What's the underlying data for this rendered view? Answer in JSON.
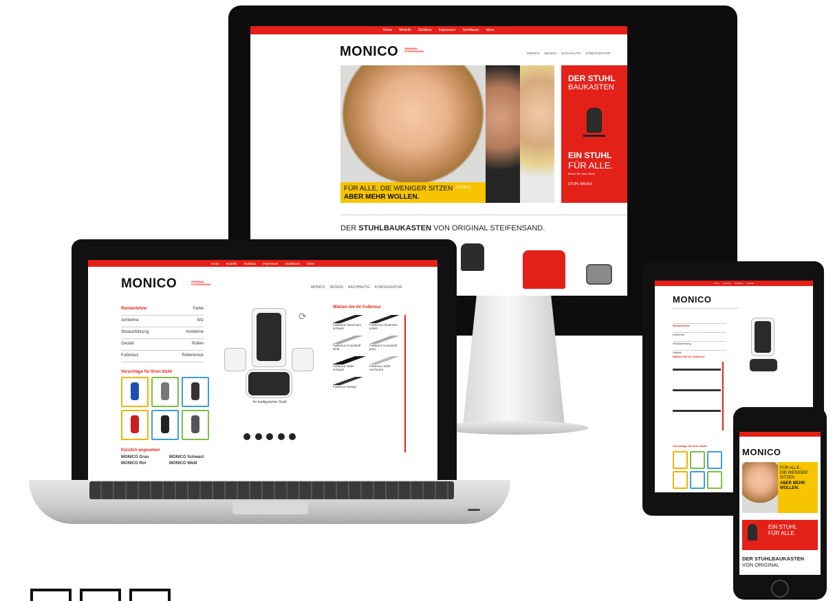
{
  "nav": {
    "items": [
      "Home",
      "Modelle",
      "Stuhlbau",
      "Impressum",
      "Stuhlbauer",
      "Ideen"
    ],
    "items_short": [
      "Home",
      "Modelle",
      "Stuhlbau",
      "Kontakt"
    ]
  },
  "header": {
    "logo": "MONICO",
    "logo_tagline_1": "ORIGINAL",
    "logo_tagline_2": "STEIFENSAND",
    "links": [
      "MONICO",
      "DESIGN",
      "NACHHALTIG",
      "KONFIGURATOR"
    ]
  },
  "desktop": {
    "hero_text_1": "FÜR ALLE, DIE WENIGER SITZEN",
    "hero_text_2": "ABER MEHR WOLLEN.",
    "hero_button": "DETAILS",
    "promo_title_1": "DER STUHL",
    "promo_title_2": "BAUKASTEN",
    "promo_slogan_1": "EIN STUHL",
    "promo_slogan_2": "FÜR ALLE.",
    "promo_small": "Bauen Sie Ihren Stuhl",
    "promo_button": "STUHL BAUEN",
    "section_prefix": "DER",
    "section_strong": "STUHLBAUKASTEN",
    "section_suffix": "VON ORIGINAL STEIFENSAND."
  },
  "configurator": {
    "filters": [
      {
        "label": "Rückenlehne",
        "value": "Farbe"
      },
      {
        "label": "Armlehne",
        "value": "Sitz"
      },
      {
        "label": "Sitzausführung",
        "value": "Armlehne"
      },
      {
        "label": "Gestell",
        "value": "Rollen"
      },
      {
        "label": "Fußkreuz",
        "value": "Rollenkreuz"
      }
    ],
    "suggestions_heading": "Vorschläge für Ihren Stuhl",
    "recent_heading": "Kürzlich angesehen",
    "recent_items": [
      "MONICO Grau",
      "MONICO Schwarz",
      "MONICO Rot",
      "MONICO Weiß"
    ],
    "options_heading": "Wählen Sie Ihr Fußkreuz",
    "options": [
      "Fußkreuz Aluminium schwarz",
      "Fußkreuz Aluminium poliert",
      "Fußkreuz Kunststoff weiß",
      "Fußkreuz Kunststoff grau",
      "Fußkreuz Stahl schwarz",
      "Fußkreuz Stahl verchromt",
      "Fußkreuz Design"
    ],
    "chair_caption": "Ihr konfigurierter Stuhl"
  },
  "phone": {
    "logo": "MONICO",
    "hero_text_1": "FÜR ALLE,",
    "hero_text_2": "DIE WENIGER SITZEN",
    "hero_text_3": "ABER MEHR WOLLEN.",
    "promo_1": "EIN STUHL",
    "promo_2": "FÜR ALLE.",
    "section_1": "DER STUHLBAUKASTEN",
    "section_2": "VON ORIGINAL"
  },
  "colors": {
    "accent_red": "#e32119",
    "accent_yellow": "#f6c400",
    "device_black": "#0d0d0d"
  }
}
